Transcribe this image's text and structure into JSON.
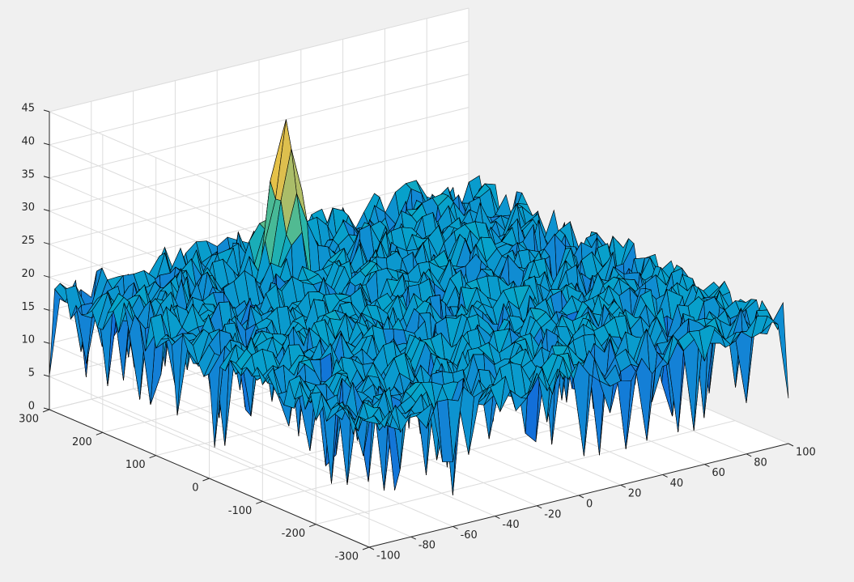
{
  "chart_data": {
    "type": "surface",
    "title": "",
    "xlabel": "",
    "ylabel": "",
    "zlabel": "",
    "grid": true,
    "colormap": "parula",
    "x_range": [
      -100,
      100
    ],
    "y_range": [
      -300,
      300
    ],
    "z_range": [
      0,
      45
    ],
    "x_ticks": [
      -100,
      -80,
      -60,
      -40,
      -20,
      0,
      20,
      40,
      60,
      80,
      100
    ],
    "y_ticks": [
      -300,
      -200,
      -100,
      0,
      100,
      200,
      300
    ],
    "z_ticks": [
      0,
      5,
      10,
      15,
      20,
      25,
      30,
      35,
      40,
      45
    ],
    "x_tick_labels": [
      "-100",
      "-80",
      "-60",
      "-40",
      "-20",
      "0",
      "20",
      "40",
      "60",
      "80",
      "100"
    ],
    "y_tick_labels": [
      "-300",
      "-200",
      "-100",
      "0",
      "100",
      "200",
      "300"
    ],
    "z_tick_labels": [
      "0",
      "5",
      "10",
      "15",
      "20",
      "25",
      "30",
      "35",
      "40",
      "45"
    ],
    "noise_floor": {
      "mean_z": 18,
      "min_z": 3,
      "max_z": 24
    },
    "peak": {
      "x": -10,
      "y": 210,
      "z": 40
    }
  }
}
